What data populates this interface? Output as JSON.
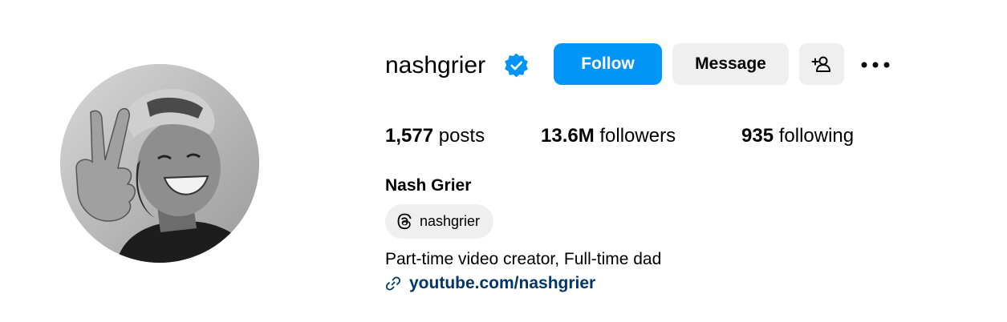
{
  "profile": {
    "username": "nashgrier",
    "verified": true,
    "full_name": "Nash Grier",
    "bio": "Part-time video creator, Full-time dad",
    "link": "youtube.com/nashgrier",
    "threads_handle": "nashgrier",
    "avatar_icon": "profile-photo"
  },
  "actions": {
    "follow_label": "Follow",
    "message_label": "Message",
    "suggest_icon": "add-person-icon",
    "more_icon": "more-options-icon"
  },
  "stats": {
    "posts": {
      "value": "1,577",
      "label": "posts"
    },
    "followers": {
      "value": "13.6M",
      "label": "followers"
    },
    "following": {
      "value": "935",
      "label": "following"
    }
  },
  "colors": {
    "accent": "#0095f6",
    "verified_badge": "#0095f6",
    "link": "#00376b",
    "secondary_button": "#efefef"
  }
}
